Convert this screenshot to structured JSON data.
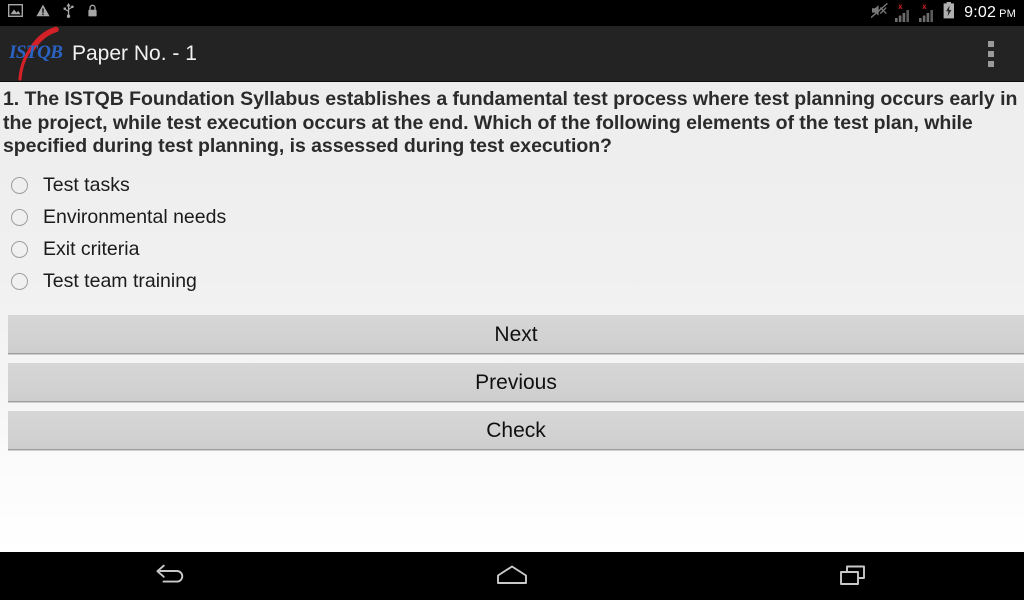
{
  "statusbar": {
    "left_icons": [
      "screenshot-icon",
      "warning-icon",
      "usb-icon",
      "lock-icon"
    ],
    "signal_icons": [
      {
        "name": "signal-bars-no-service-1",
        "badge": "x"
      },
      {
        "name": "signal-bars-no-service-2",
        "badge": "x"
      }
    ],
    "mute_icon": "volume-muted-icon",
    "battery_icon": "battery-charging-icon",
    "time": "9:02",
    "ampm": "PM",
    "background": "#000000",
    "badge_color": "#cc2020"
  },
  "actionbar": {
    "logo_text": "ISTQB",
    "logo_color": "#2a63c4",
    "logo_swoosh_color": "#d42027",
    "title": "Paper No. - 1",
    "overflow_icon": "overflow-menu-icon",
    "background": "#232323"
  },
  "quiz": {
    "question": "1. The ISTQB Foundation Syllabus establishes a fundamental test process where test planning occurs early in the project, while test execution occurs at the end. Which of the following elements of the test plan, while specified during test planning, is assessed during test execution?",
    "options": [
      {
        "label": "Test tasks",
        "selected": false
      },
      {
        "label": "Environmental needs",
        "selected": false
      },
      {
        "label": "Exit criteria",
        "selected": false
      },
      {
        "label": "Test team training",
        "selected": false
      }
    ],
    "buttons": [
      {
        "label": "Next",
        "name": "next-button"
      },
      {
        "label": "Previous",
        "name": "previous-button"
      },
      {
        "label": "Check",
        "name": "check-button"
      }
    ]
  },
  "navbar": {
    "items": [
      {
        "name": "nav-back-icon"
      },
      {
        "name": "nav-home-icon"
      },
      {
        "name": "nav-recents-icon"
      }
    ],
    "background": "#000000"
  }
}
